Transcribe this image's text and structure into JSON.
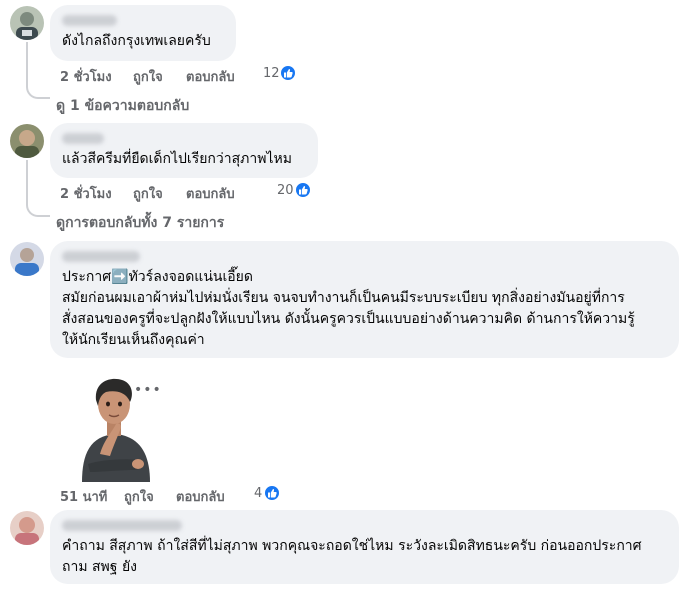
{
  "comments": [
    {
      "text": "ดังไกลถึงกรุงเทพเลยครับ",
      "time": "2 ชั่วโมง",
      "like_label": "ถูกใจ",
      "reply_label": "ตอบกลับ",
      "likes": "12",
      "replies_text": "ดู 1 ข้อความตอบกลับ"
    },
    {
      "text": "แล้วสีครีมที่ยืดเด็กไปเรียกว่าสุภาพไหม",
      "time": "2 ชั่วโมง",
      "like_label": "ถูกใจ",
      "reply_label": "ตอบกลับ",
      "likes": "20",
      "replies_text": "ดูการตอบกลับทั้ง 7 รายการ"
    },
    {
      "lines": [
        "ประกาศ➡️ทัวร์ลงจอดแน่นเอี๊ยด",
        "สมัยก่อนผมเอาผ้าห่มไปห่มนั่งเรียน จนจบทำงานก็เป็นคนมีระบบระเบียบ ทุกสิ่งอย่างมันอยู่ที่การ",
        "สั่งสอนของครูที่จะปลูกฝังให้แบบไหน ดังนั้นครูควรเป็นแบบอย่างด้านความคิด ด้านการให้ความรู้",
        "ให้นักเรียนเห็นถึงคุณค่า"
      ],
      "time": "51 นาที",
      "like_label": "ถูกใจ",
      "reply_label": "ตอบกลับ",
      "likes": "4",
      "more_label": "•••"
    },
    {
      "lines": [
        "คำถาม สีสุภาพ ถ้าใส่สีที่ไม่สุภาพ พวกคุณจะถอดใช่ไหม ระวังละเมิดสิทธนะครับ ก่อนออกประกาศ",
        "ถาม สพฐ ยัง"
      ]
    }
  ],
  "colors": {
    "bubble": "#f0f2f5",
    "meta": "#65676b",
    "like_blue": "#1877f2"
  },
  "icons": [
    "like-thumb-icon",
    "more-options-icon"
  ]
}
